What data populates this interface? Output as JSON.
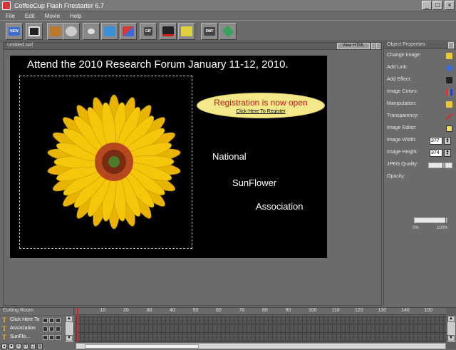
{
  "window": {
    "title": "CoffeeCup Flash Firestarter 6.7",
    "min": "_",
    "max": "□",
    "close": "×"
  },
  "menu": [
    "File",
    "Edit",
    "Movie",
    "Help"
  ],
  "toolbar": {
    "new_label": "NEW",
    "buttons": [
      {
        "icon": "new-icon",
        "color": "#3a6bd6"
      },
      {
        "icon": "save-icon",
        "color": "#222222"
      },
      {
        "icon": "text-tool-icon",
        "color": "#b87a2c"
      },
      {
        "icon": "film-icon",
        "color": "#cccccc"
      },
      {
        "icon": "sound-icon",
        "color": "#cccccc"
      },
      {
        "icon": "image-icon",
        "color": "#3a8fd6"
      },
      {
        "icon": "shapes-icon",
        "color": "#d33a3a"
      },
      {
        "icon": "gif-icon",
        "color": "#444444"
      },
      {
        "icon": "magic-hat-icon",
        "color": "#222222"
      },
      {
        "icon": "basket-icon",
        "color": "#e0d040"
      },
      {
        "icon": "swf-icon",
        "color": "#444444"
      },
      {
        "icon": "publish-icon",
        "color": "#3aa05a"
      }
    ],
    "gif_label": "GIF",
    "swf_label": "SWF"
  },
  "document": {
    "title": "Untitled.swf",
    "view_html": "View HTML",
    "stage": {
      "headline": "Attend the 2010 Research Forum January 11-12, 2010.",
      "registration_title": "Registration is now open",
      "registration_link": "Click Here To Register",
      "words": [
        "National",
        "SunFlower",
        "Association"
      ]
    }
  },
  "properties": {
    "title": "Object Properties",
    "rows": [
      {
        "label": "Change Image:",
        "icon": "folder-icon"
      },
      {
        "label": "Add Link:",
        "icon": "link-icon"
      },
      {
        "label": "Add Effect:",
        "icon": "effect-icon"
      },
      {
        "label": "Image Colors:",
        "icon": "palette-icon"
      },
      {
        "label": "Manipulation:",
        "icon": "manipulate-icon"
      },
      {
        "label": "Transparency:",
        "icon": "dropper-icon"
      },
      {
        "label": "Image Editor:",
        "icon": "editor-icon"
      }
    ],
    "image_width_label": "Image Width:",
    "image_width": "377",
    "image_height_label": "Image Height:",
    "image_height": "374",
    "jpeg_quality_label": "JPEG Quality:",
    "jpeg_quality": 0.62,
    "opacity_label": "Opacity:",
    "opacity": 1.0,
    "opacity_min": "0%",
    "opacity_max": "100%"
  },
  "timeline": {
    "title": "Cutting Room",
    "ticks": [
      "0",
      "10",
      "20",
      "30",
      "40",
      "50",
      "60",
      "70",
      "80",
      "90",
      "100",
      "110",
      "120",
      "130",
      "140",
      "150"
    ],
    "layers": [
      {
        "name": "Click Here To"
      },
      {
        "name": "Association"
      },
      {
        "name": "SunFlo..."
      }
    ]
  },
  "colors": {
    "stage_bg": "#000000",
    "badge_bg": "#f3e98a",
    "badge_text": "#c31a1a",
    "petal": "#f5c60a",
    "center": "#b5481d"
  }
}
